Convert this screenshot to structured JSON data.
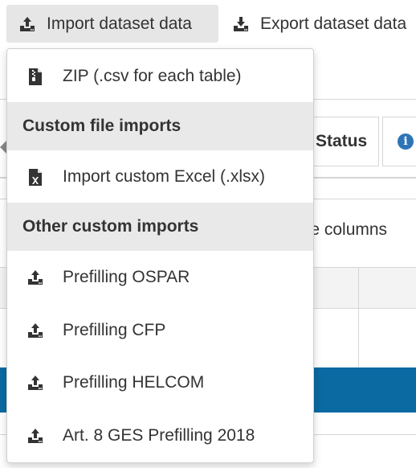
{
  "toolbar": {
    "import_label": "Import dataset data",
    "export_label": "Export dataset data"
  },
  "background": {
    "tab_status": "Status",
    "info_icon_text": "i",
    "hide_columns_text": "ide columns"
  },
  "dropdown": {
    "zip_item": "ZIP (.csv for each table)",
    "custom_file_header": "Custom file imports",
    "excel_item": "Import custom Excel (.xlsx)",
    "other_custom_header": "Other custom imports",
    "prefill_items": [
      "Prefilling OSPAR",
      "Prefilling CFP",
      "Prefilling HELCOM",
      "Art. 8 GES Prefilling 2018"
    ]
  },
  "colors": {
    "accent_blue": "#0a6aa1",
    "menu_header_bg": "#e9e9e9",
    "button_bg": "#e6e6e6"
  }
}
